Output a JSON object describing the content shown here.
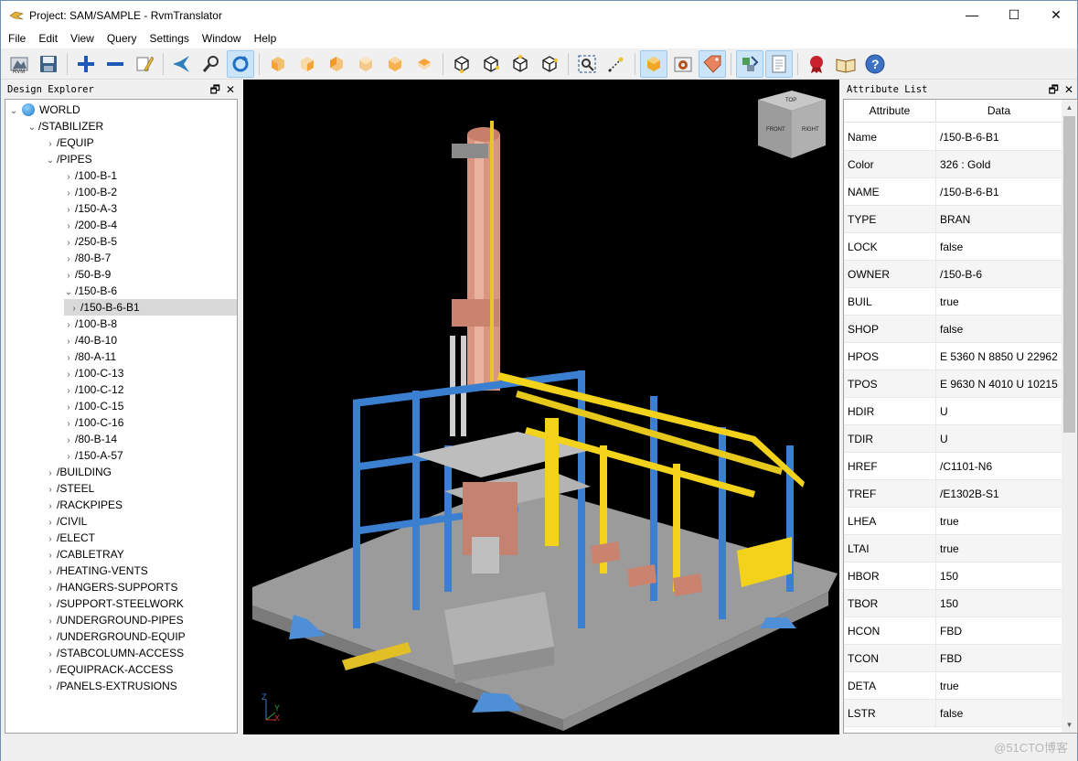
{
  "window": {
    "title": "Project: SAM/SAMPLE - RvmTranslator",
    "min_label": "—",
    "max_label": "☐",
    "close_label": "✕"
  },
  "menu": [
    "File",
    "Edit",
    "View",
    "Query",
    "Settings",
    "Window",
    "Help"
  ],
  "toolbar": {
    "icons": [
      "open-rvm-icon",
      "save-icon",
      "expand-icon",
      "collapse-icon",
      "clear-icon",
      "fly-icon",
      "search-icon",
      "refresh-icon",
      "view-box-1-icon",
      "view-box-2-icon",
      "view-box-3-icon",
      "view-box-4-icon",
      "view-box-5-icon",
      "view-box-6-icon",
      "iso-box-1-icon",
      "iso-box-2-icon",
      "iso-box-3-icon",
      "iso-box-4-icon",
      "zoom-fit-icon",
      "axis-icon",
      "shaded-icon",
      "settings-icon",
      "tag-icon",
      "clip-icon",
      "document-icon",
      "certificate-icon",
      "book-icon",
      "help-icon"
    ],
    "active": [
      "view-box-shaded",
      "tag-icon",
      "clip-icon",
      "document-icon"
    ]
  },
  "explorer": {
    "title": "Design Explorer",
    "tree": [
      {
        "label": "WORLD",
        "level": 0,
        "arrow": "v",
        "icon": true
      },
      {
        "label": "/STABILIZER",
        "level": 1,
        "arrow": "v"
      },
      {
        "label": "/EQUIP",
        "level": 2,
        "arrow": ">"
      },
      {
        "label": "/PIPES",
        "level": 2,
        "arrow": "v"
      },
      {
        "label": "/100-B-1",
        "level": 3,
        "arrow": ">"
      },
      {
        "label": "/100-B-2",
        "level": 3,
        "arrow": ">"
      },
      {
        "label": "/150-A-3",
        "level": 3,
        "arrow": ">"
      },
      {
        "label": "/200-B-4",
        "level": 3,
        "arrow": ">"
      },
      {
        "label": "/250-B-5",
        "level": 3,
        "arrow": ">"
      },
      {
        "label": "/80-B-7",
        "level": 3,
        "arrow": ">"
      },
      {
        "label": "/50-B-9",
        "level": 3,
        "arrow": ">"
      },
      {
        "label": "/150-B-6",
        "level": 3,
        "arrow": "v"
      },
      {
        "label": "/150-B-6-B1",
        "level": 4,
        "arrow": ">",
        "selected": true
      },
      {
        "label": "/100-B-8",
        "level": 3,
        "arrow": ">"
      },
      {
        "label": "/40-B-10",
        "level": 3,
        "arrow": ">"
      },
      {
        "label": "/80-A-11",
        "level": 3,
        "arrow": ">"
      },
      {
        "label": "/100-C-13",
        "level": 3,
        "arrow": ">"
      },
      {
        "label": "/100-C-12",
        "level": 3,
        "arrow": ">"
      },
      {
        "label": "/100-C-15",
        "level": 3,
        "arrow": ">"
      },
      {
        "label": "/100-C-16",
        "level": 3,
        "arrow": ">"
      },
      {
        "label": "/80-B-14",
        "level": 3,
        "arrow": ">"
      },
      {
        "label": "/150-A-57",
        "level": 3,
        "arrow": ">"
      },
      {
        "label": "/BUILDING",
        "level": 2,
        "arrow": ">"
      },
      {
        "label": "/STEEL",
        "level": 2,
        "arrow": ">"
      },
      {
        "label": "/RACKPIPES",
        "level": 2,
        "arrow": ">"
      },
      {
        "label": "/CIVIL",
        "level": 2,
        "arrow": ">"
      },
      {
        "label": "/ELECT",
        "level": 2,
        "arrow": ">"
      },
      {
        "label": "/CABLETRAY",
        "level": 2,
        "arrow": ">"
      },
      {
        "label": "/HEATING-VENTS",
        "level": 2,
        "arrow": ">"
      },
      {
        "label": "/HANGERS-SUPPORTS",
        "level": 2,
        "arrow": ">"
      },
      {
        "label": "/SUPPORT-STEELWORK",
        "level": 2,
        "arrow": ">"
      },
      {
        "label": "/UNDERGROUND-PIPES",
        "level": 2,
        "arrow": ">"
      },
      {
        "label": "/UNDERGROUND-EQUIP",
        "level": 2,
        "arrow": ">"
      },
      {
        "label": "/STABCOLUMN-ACCESS",
        "level": 2,
        "arrow": ">"
      },
      {
        "label": "/EQUIPRACK-ACCESS",
        "level": 2,
        "arrow": ">"
      },
      {
        "label": "/PANELS-EXTRUSIONS",
        "level": 2,
        "arrow": ">"
      }
    ]
  },
  "viewport": {
    "viewcube_faces": [
      "TOP",
      "FRONT",
      "RIGHT"
    ],
    "axes": [
      "Z",
      "Y",
      "X"
    ]
  },
  "attributes": {
    "title": "Attribute List",
    "headers": [
      "Attribute",
      "Data"
    ],
    "rows": [
      [
        "Name",
        "/150-B-6-B1"
      ],
      [
        "Color",
        "326 : Gold"
      ],
      [
        "NAME",
        "/150-B-6-B1"
      ],
      [
        "TYPE",
        "BRAN"
      ],
      [
        "LOCK",
        "false"
      ],
      [
        "OWNER",
        "/150-B-6"
      ],
      [
        "BUIL",
        "true"
      ],
      [
        "SHOP",
        "false"
      ],
      [
        "HPOS",
        "E 5360 N 8850 U 22962"
      ],
      [
        "TPOS",
        "E 9630 N 4010 U 10215"
      ],
      [
        "HDIR",
        "U"
      ],
      [
        "TDIR",
        "U"
      ],
      [
        "HREF",
        "/C1101-N6"
      ],
      [
        "TREF",
        "/E1302B-S1"
      ],
      [
        "LHEA",
        "true"
      ],
      [
        "LTAI",
        "true"
      ],
      [
        "HBOR",
        "150"
      ],
      [
        "TBOR",
        "150"
      ],
      [
        "HCON",
        "FBD"
      ],
      [
        "TCON",
        "FBD"
      ],
      [
        "DETA",
        "true"
      ],
      [
        "LSTR",
        "false"
      ]
    ]
  },
  "watermark": "@51CTO博客",
  "colors": {
    "accent": "#0078d7",
    "pipe": "#f2d21b",
    "steel": "#3b7fd1",
    "vessel": "#d99b86",
    "deck": "#a7a7a7"
  }
}
